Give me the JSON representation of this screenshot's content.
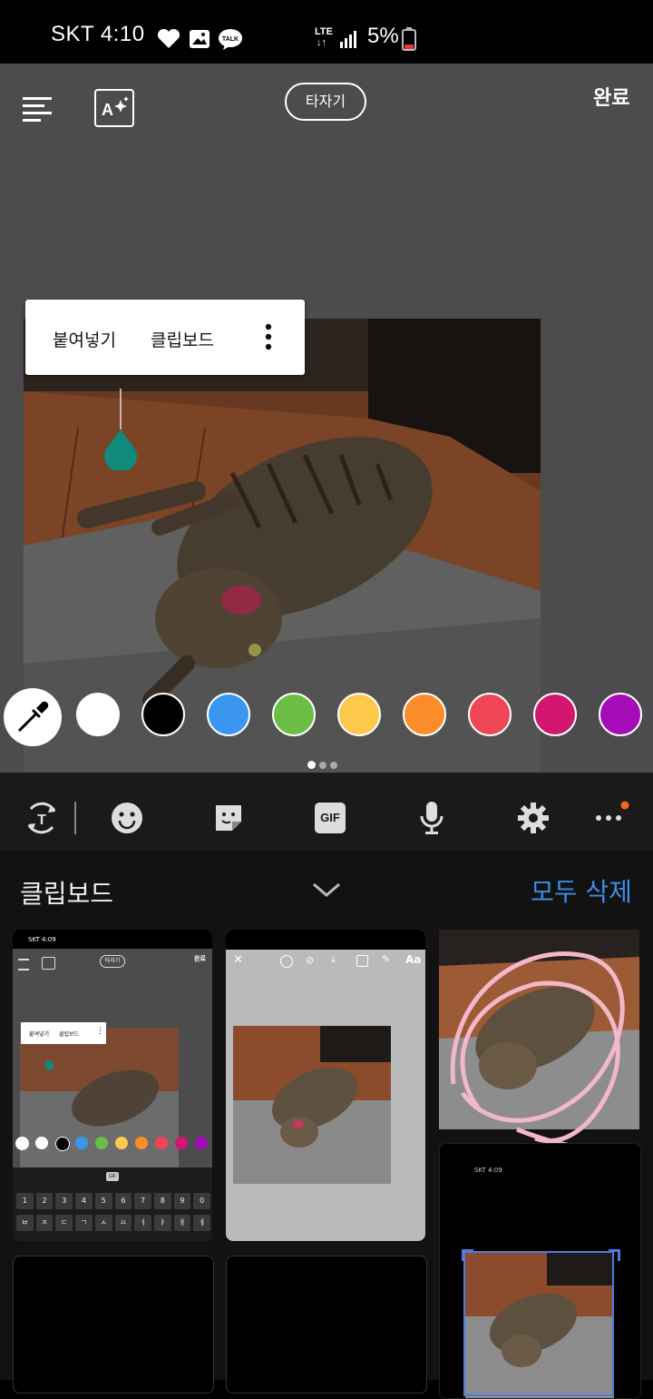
{
  "status_bar": {
    "carrier_time": "SKT 4:10",
    "network": "LTE",
    "battery": "5%"
  },
  "editor": {
    "mode_button": "타자기",
    "done_label": "완료",
    "context_menu": {
      "paste": "붙여넣기",
      "clipboard": "클립보드"
    },
    "colors": [
      "#ffffff",
      "#000000",
      "#3a96f0",
      "#6cbd45",
      "#fdc94d",
      "#fd8d2a",
      "#ef4655",
      "#d3166f",
      "#a60bba"
    ]
  },
  "keyboard_toolbar": {
    "gif_label": "GIF"
  },
  "clipboard_panel": {
    "title": "클립보드",
    "delete_all": "모두 삭제",
    "thumb1": {
      "status": "SKT 4:09",
      "mode_button": "타자기",
      "done": "완료",
      "paste": "붙여넣기",
      "clipboard": "클립보드",
      "gif": "GIF",
      "number_row": [
        "1",
        "2",
        "3",
        "4",
        "5",
        "6",
        "7",
        "8",
        "9",
        "0"
      ],
      "hangul_row": [
        "ㅂ",
        "ㅈ",
        "ㄷ",
        "ㄱ",
        "ㅅ",
        "ㅛ",
        "ㅕ",
        "ㅑ",
        "ㅐ",
        "ㅔ"
      ]
    },
    "thumb2": {
      "aa": "Aa"
    },
    "thumb5": {
      "status": "SKT 4:09"
    }
  }
}
